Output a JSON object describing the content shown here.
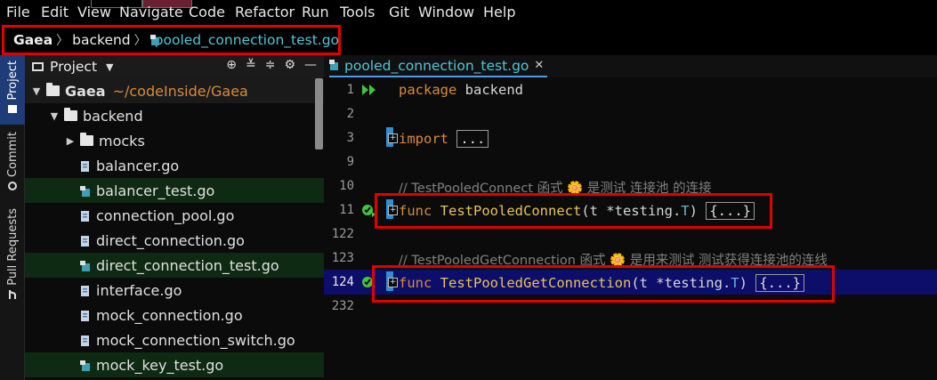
{
  "menu": [
    "File",
    "Edit",
    "View",
    "Navigate",
    "Code",
    "Refactor",
    "Run",
    "Tools",
    "Git",
    "Window",
    "Help"
  ],
  "breadcrumb": {
    "root": "Gaea",
    "folder": "backend",
    "file": "pooled_connection_test.go"
  },
  "toolstrip": {
    "project": "Project",
    "commit": "Commit",
    "pull_requests": "Pull Requests"
  },
  "project_panel": {
    "title": "Project",
    "root": {
      "name": "Gaea",
      "path": "~/codeInside/Gaea"
    },
    "items": [
      {
        "name": "backend",
        "kind": "folder"
      },
      {
        "name": "mocks",
        "kind": "folder"
      },
      {
        "name": "balancer.go",
        "kind": "file"
      },
      {
        "name": "balancer_test.go",
        "kind": "test"
      },
      {
        "name": "connection_pool.go",
        "kind": "file"
      },
      {
        "name": "direct_connection.go",
        "kind": "file"
      },
      {
        "name": "direct_connection_test.go",
        "kind": "test"
      },
      {
        "name": "interface.go",
        "kind": "file"
      },
      {
        "name": "mock_connection.go",
        "kind": "file"
      },
      {
        "name": "mock_connection_switch.go",
        "kind": "file"
      },
      {
        "name": "mock_key_test.go",
        "kind": "test"
      }
    ]
  },
  "editor": {
    "tab": "pooled_connection_test.go",
    "lines": [
      {
        "n": "1"
      },
      {
        "n": "2"
      },
      {
        "n": "3"
      },
      {
        "n": "9"
      },
      {
        "n": "10"
      },
      {
        "n": "11"
      },
      {
        "n": "122"
      },
      {
        "n": "123"
      },
      {
        "n": "124"
      },
      {
        "n": "232"
      }
    ],
    "code": {
      "pkg_kw": "package",
      "pkg_name": "backend",
      "import_kw": "import",
      "fold": "...",
      "c1": "// TestPooledConnect 函式 🌼 是测试 连接池 的连接",
      "func_kw": "func",
      "fn1": "TestPooledConnect",
      "fn1_args_a": "(t *testing.",
      "fn1_type": "T",
      "fn1_args_b": ")",
      "fold1": "{...}",
      "c2": "// TestPooledGetConnection 函式 🌼 是用来测试 测试获得连接池的连线",
      "fn2": "TestPooledGetConnection",
      "fn2_args_a": "(t *testing.",
      "fn2_type": "T",
      "fn2_args_b": ")",
      "fold2": "{...}"
    }
  }
}
